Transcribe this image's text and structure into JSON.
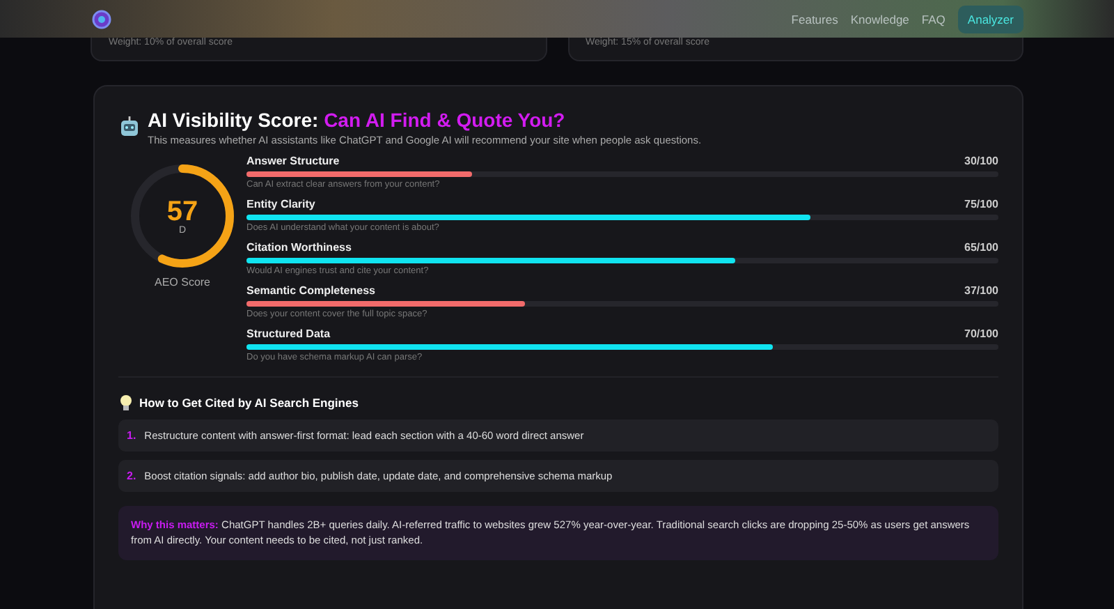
{
  "nav": {
    "links": [
      "Features",
      "Knowledge",
      "FAQ"
    ],
    "cta": "Analyzer"
  },
  "top_cards": [
    {
      "note": "Weight: 10% of overall score"
    },
    {
      "note": "Weight: 15% of overall score"
    }
  ],
  "visibility": {
    "title": "AI Visibility Score:",
    "highlight": "Can AI Find & Quote You?",
    "subtitle": "This measures whether AI assistants like ChatGPT and Google AI will recommend your site when people ask questions.",
    "score": {
      "value": "57",
      "grade": "D",
      "label": "AEO Score",
      "level": 0.57
    },
    "metrics": [
      {
        "name": "Answer Structure",
        "reading": "30/100",
        "level": 0.3,
        "color": "#f26b6b",
        "hint": "Can AI extract clear answers from your content?"
      },
      {
        "name": "Entity Clarity",
        "reading": "75/100",
        "level": 0.75,
        "color": "#10e4f0",
        "hint": "Does AI understand what your content is about?"
      },
      {
        "name": "Citation Worthiness",
        "reading": "65/100",
        "level": 0.65,
        "color": "#10e4f0",
        "hint": "Would AI engines trust and cite your content?"
      },
      {
        "name": "Semantic Completeness",
        "reading": "37/100",
        "level": 0.37,
        "color": "#f26b6b",
        "hint": "Does your content cover the full topic space?"
      },
      {
        "name": "Structured Data",
        "reading": "70/100",
        "level": 0.7,
        "color": "#10e4f0",
        "hint": "Do you have schema markup AI can parse?"
      }
    ],
    "tips_title": "How to Get Cited by AI Search Engines",
    "tips": [
      {
        "number": "1.",
        "text": "Restructure content with answer-first format: lead each section with a 40-60 word direct answer"
      },
      {
        "number": "2.",
        "text": "Boost citation signals: add author bio, publish date, update date, and comprehensive schema markup"
      }
    ],
    "why": {
      "label": "Why this matters:",
      "text": "ChatGPT handles 2B+ queries daily. AI-referred traffic to websites grew 527% year-over-year. Traditional search clicks are dropping 25-50% as users get answers from AI directly. Your content needs to be cited, not just ranked."
    }
  }
}
